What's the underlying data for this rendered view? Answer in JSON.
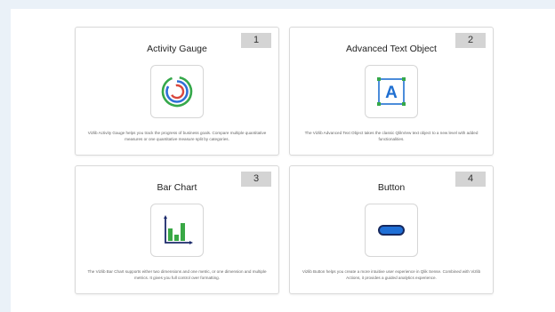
{
  "colors": {
    "background": "#eaf1f8",
    "card_border": "#d9d9d9",
    "badge_bg": "#d4d4d4",
    "gauge_blue": "#2f6fd6",
    "gauge_green": "#35a84a",
    "gauge_red": "#d9473d",
    "bar_green": "#39a845",
    "axis_navy": "#1b2a6b",
    "text_object_blue": "#1f6fd1",
    "text_object_green": "#35a84a",
    "button_navy": "#16285e",
    "button_blue": "#1f6fd6"
  },
  "cards": [
    {
      "number": "1",
      "title": "Activity Gauge",
      "icon": "activity-gauge-icon",
      "description": "Vizlib Activity Gauge helps you track the progress of business goals. Compare multiple quantitative measures or one quantitative measure split by categories."
    },
    {
      "number": "2",
      "title": "Advanced Text Object",
      "icon": "advanced-text-object-icon",
      "icon_letter": "A",
      "description": "The Vizlib Advanced Text Object takes the classic QlikView text object to a new level with added functionalities."
    },
    {
      "number": "3",
      "title": "Bar Chart",
      "icon": "bar-chart-icon",
      "description": "The Vizlib Bar Chart supports either two dimensions and one metric, or one dimension and multiple metrics. It gives you full control over formatting."
    },
    {
      "number": "4",
      "title": "Button",
      "icon": "button-icon",
      "description": "Vizlib Button helps you create a more intuitive user experience in Qlik Sense. Combined with Vizlib Actions, it provides a guided analytics experience."
    }
  ]
}
